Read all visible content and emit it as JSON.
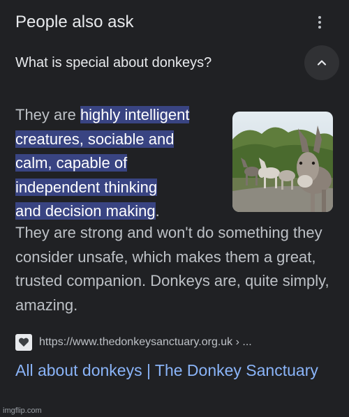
{
  "header": {
    "title": "People also ask"
  },
  "question": {
    "text": "What is special about donkeys?"
  },
  "answer": {
    "lead": "They are ",
    "highlight_lines": [
      "highly intelligent",
      "creatures, sociable and",
      "calm, capable of",
      "independent thinking",
      "and decision making"
    ],
    "highlight_end": ".",
    "rest": "They are strong and won't do something they consider unsafe, which makes them a great, trusted companion. Donkeys are, quite simply, amazing."
  },
  "source": {
    "url": "https://www.thedonkeysanctuary.org.uk › ...",
    "title": "All about donkeys | The Donkey Sanctuary"
  },
  "watermark": "imgflip.com",
  "colors": {
    "background": "#202124",
    "highlight": "#394482",
    "link": "#8ab4f8"
  }
}
